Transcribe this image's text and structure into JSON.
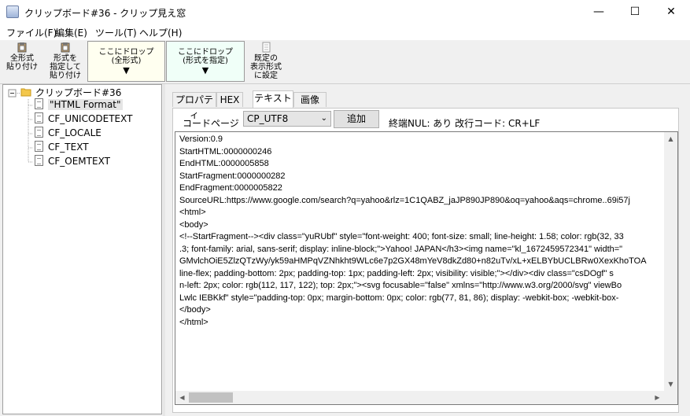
{
  "window": {
    "title": "クリップボード#36 - クリップ見え窓",
    "minimize": "—",
    "maximize": "☐",
    "close": "✕"
  },
  "menu": [
    "ファイル(F)",
    "編集(E)",
    "ツール(T)",
    "ヘルプ(H)"
  ],
  "toolbar": {
    "paste_all": [
      "全形式",
      "貼り付け"
    ],
    "paste_spec": [
      "形式を",
      "指定して",
      "貼り付け"
    ],
    "drop_all": [
      "ここにドロップ",
      "(全形式)"
    ],
    "drop_spec": [
      "ここにドロップ",
      "(形式を指定)"
    ],
    "default_fmt": [
      "既定の",
      "表示形式",
      "に設定"
    ],
    "drop_arrow": "▼"
  },
  "tree": {
    "root": "クリップボード#36",
    "items": [
      "\"HTML Format\"",
      "CF_UNICODETEXT",
      "CF_LOCALE",
      "CF_TEXT",
      "CF_OEMTEXT"
    ]
  },
  "tabs": [
    "プロパティ",
    "HEX",
    "テキスト",
    "画像"
  ],
  "codepage": {
    "label": "コードページ",
    "value": "CP_UTF8",
    "add": "追加",
    "info": "終端NUL: あり  改行コード: CR+LF"
  },
  "content_lines": [
    "Version:0.9",
    "StartHTML:0000000246",
    "EndHTML:0000005858",
    "StartFragment:0000000282",
    "EndFragment:0000005822",
    "SourceURL:https://www.google.com/search?q=yahoo&rlz=1C1QABZ_jaJP890JP890&oq=yahoo&aqs=chrome..69i57j",
    "<html>",
    "<body>",
    "<!--StartFragment--><div class=\"yuRUbf\" style=\"font-weight: 400; font-size: small; line-height: 1.58; color: rgb(32, 33",
    ".3; font-family: arial, sans-serif; display: inline-block;\">Yahoo! JAPAN</h3><img name=\"kl_1672459572341\" width=\"",
    "GMvlchOiE5ZlzQTzWy/yk59aHMPqVZNhkht9WLc6e7p2GX48mYeV8dkZd80+n82uTv/xL+xELBYbUCLBRw0XexKhoTOA",
    "line-flex; padding-bottom: 2px; padding-top: 1px; padding-left: 2px; visibility: visible;\"></div><div class=\"csDOgf\" s",
    "n-left: 2px; color: rgb(112, 117, 122); top: 2px;\"><svg focusable=\"false\" xmlns=\"http://www.w3.org/2000/svg\" viewBo",
    "Lwlc IEBKkf\" style=\"padding-top: 0px; margin-bottom: 0px; color: rgb(77, 81, 86); display: -webkit-box; -webkit-box-",
    "</body>",
    "</html>"
  ]
}
